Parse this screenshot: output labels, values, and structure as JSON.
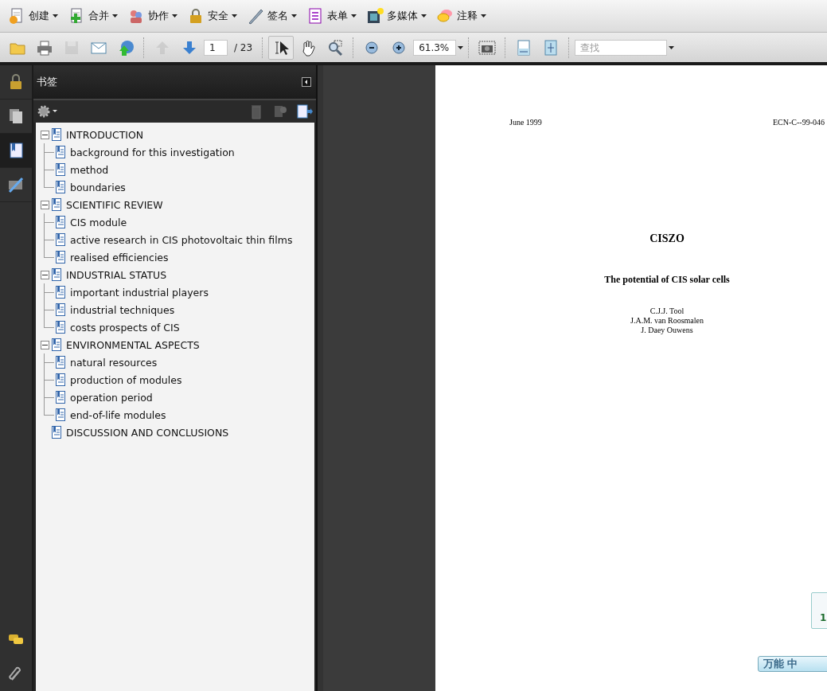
{
  "menu": [
    {
      "kind": "create",
      "label": "创建"
    },
    {
      "kind": "combine",
      "label": "合并"
    },
    {
      "kind": "collaborate",
      "label": "协作"
    },
    {
      "kind": "secure",
      "label": "安全"
    },
    {
      "kind": "sign",
      "label": "签名"
    },
    {
      "kind": "forms",
      "label": "表单"
    },
    {
      "kind": "multimedia",
      "label": "多媒体"
    },
    {
      "kind": "comment",
      "label": "注释"
    }
  ],
  "toolbar": {
    "file_buttons": [
      {
        "kind": "open",
        "disabled": false
      },
      {
        "kind": "print",
        "disabled": false
      },
      {
        "kind": "save",
        "disabled": true
      },
      {
        "kind": "email",
        "disabled": false
      },
      {
        "kind": "upload",
        "disabled": false
      }
    ],
    "nav_buttons": [
      {
        "kind": "previous",
        "disabled": true
      },
      {
        "kind": "next",
        "disabled": false
      }
    ],
    "page_field": {
      "value": "1"
    },
    "page_total": "/ 23",
    "tools": [
      {
        "kind": "select",
        "selected": true
      },
      {
        "kind": "hand",
        "selected": false
      },
      {
        "kind": "marquee-zoom",
        "selected": false
      }
    ],
    "zoom_field": {
      "value": "61.3%"
    },
    "view_buttons": [
      {
        "kind": "snapshot"
      },
      {
        "kind": "fit-width"
      },
      {
        "kind": "fit-page"
      }
    ],
    "search_field": {
      "placeholder": "查找"
    }
  },
  "left_nav": [
    {
      "kind": "lock",
      "selected": false
    },
    {
      "kind": "pages",
      "selected": false
    },
    {
      "kind": "bookmarks",
      "selected": true
    },
    {
      "kind": "signatures",
      "selected": false
    }
  ],
  "left_nav_bottom": [
    {
      "kind": "comments"
    },
    {
      "kind": "attachments"
    }
  ],
  "bookmarks": {
    "title": "书签",
    "items": [
      {
        "label": "INTRODUCTION",
        "expanded": true,
        "children": [
          {
            "label": "background for this investigation"
          },
          {
            "label": "method"
          },
          {
            "label": "boundaries"
          }
        ]
      },
      {
        "label": "SCIENTIFIC REVIEW",
        "expanded": true,
        "children": [
          {
            "label": "CIS module"
          },
          {
            "label": "active research in CIS photovoltaic thin films"
          },
          {
            "label": "realised efficiencies"
          }
        ]
      },
      {
        "label": "INDUSTRIAL STATUS",
        "expanded": true,
        "children": [
          {
            "label": "important industrial players"
          },
          {
            "label": "industrial techniques"
          },
          {
            "label": "costs prospects of CIS"
          }
        ]
      },
      {
        "label": "ENVIRONMENTAL ASPECTS",
        "expanded": true,
        "children": [
          {
            "label": "natural resources"
          },
          {
            "label": "production of modules"
          },
          {
            "label": "operation period"
          },
          {
            "label": "end-of-life modules"
          }
        ]
      },
      {
        "label": "DISCUSSION AND CONCLUSIONS"
      }
    ]
  },
  "document": {
    "header_left": "June 1999",
    "header_right": "ECN-C--99-046",
    "title": "CISZO",
    "subtitle": "The potential of CIS solar cells",
    "authors": [
      "C.J.J. Tool",
      "J.A.M. van Roosmalen",
      "J. Daey Ouwens"
    ]
  },
  "page_badge": "1",
  "ime_bar": {
    "label": "万能",
    "mode": "中"
  }
}
